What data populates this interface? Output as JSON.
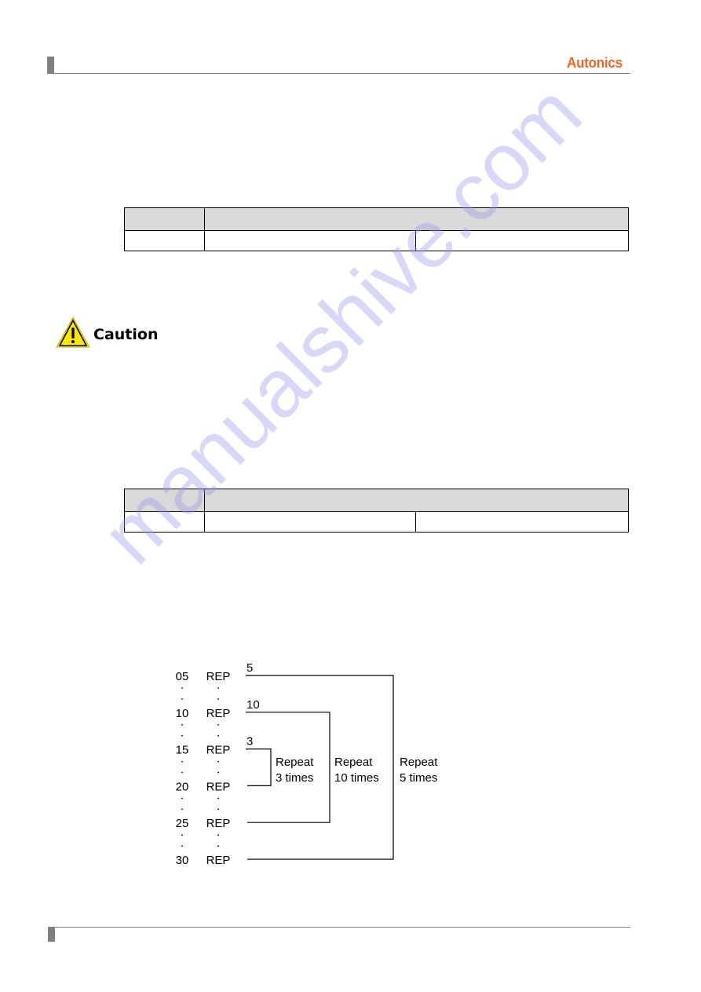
{
  "header": {
    "logo_text": "Autonics",
    "logo_color": "#f26522"
  },
  "tables": [
    {
      "header_row": [
        "",
        ""
      ],
      "body_row": [
        "",
        "",
        ""
      ]
    },
    {
      "header_row": [
        "",
        ""
      ],
      "body_row": [
        "",
        "",
        ""
      ]
    }
  ],
  "caution": {
    "icon": "warning-triangle-icon",
    "label": "Caution",
    "icon_color": "#ffe600"
  },
  "diagram": {
    "rows": [
      {
        "step": "05",
        "command": "REP"
      },
      {
        "step": "10",
        "command": "REP"
      },
      {
        "step": "15",
        "command": "REP"
      },
      {
        "step": "20",
        "command": "REP"
      },
      {
        "step": "25",
        "command": "REP"
      },
      {
        "step": "30",
        "command": "REP"
      }
    ],
    "loops": [
      {
        "count": "5",
        "from_row": 0,
        "to_row": 5,
        "caption_line1": "Repeat",
        "caption_line2": "5 times"
      },
      {
        "count": "10",
        "from_row": 1,
        "to_row": 4,
        "caption_line1": "Repeat",
        "caption_line2": "10 times"
      },
      {
        "count": "3",
        "from_row": 2,
        "to_row": 3,
        "caption_line1": "Repeat",
        "caption_line2": "3 times"
      }
    ]
  },
  "watermark": "manualshive.com"
}
